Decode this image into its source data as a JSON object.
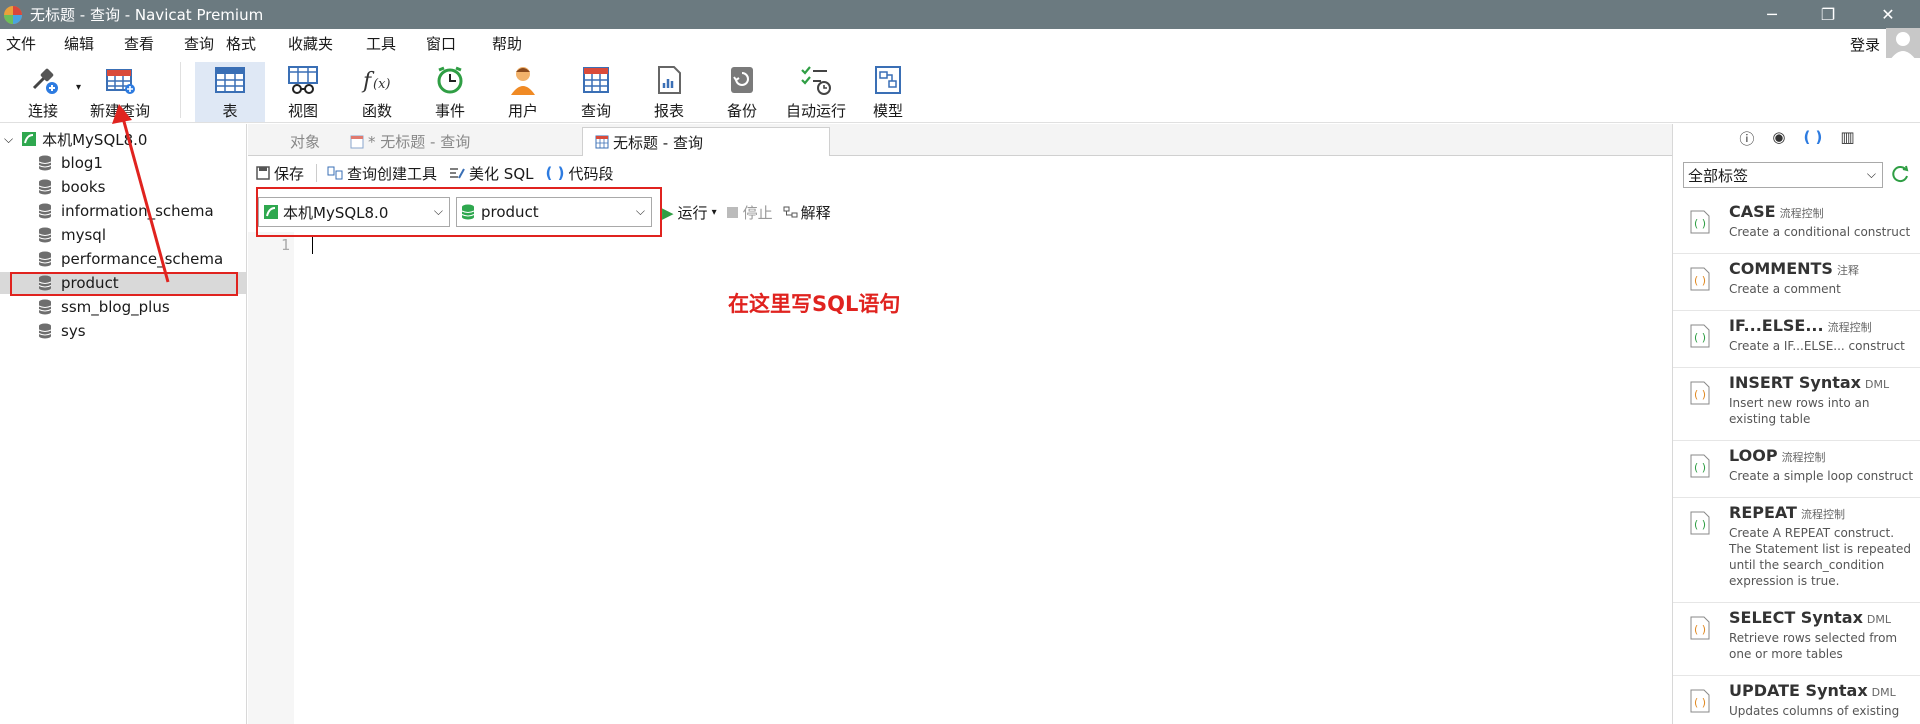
{
  "window": {
    "title": "无标题 - 查询 - Navicat Premium",
    "controls": [
      "minimize-icon",
      "restore-icon",
      "close-icon"
    ]
  },
  "menu": [
    "文件",
    "编辑",
    "查看",
    "查询",
    "格式",
    "收藏夹",
    "工具",
    "窗口",
    "帮助"
  ],
  "account": {
    "login_label": "登录"
  },
  "toolbar": {
    "items": [
      {
        "label": "连接",
        "icon": "plug-icon"
      },
      {
        "label": "新建查询",
        "icon": "new-query-icon"
      },
      {
        "label": "表",
        "icon": "table-icon"
      },
      {
        "label": "视图",
        "icon": "view-icon"
      },
      {
        "label": "函数",
        "icon": "function-icon"
      },
      {
        "label": "事件",
        "icon": "clock-icon"
      },
      {
        "label": "用户",
        "icon": "user-icon"
      },
      {
        "label": "查询",
        "icon": "query-icon"
      },
      {
        "label": "报表",
        "icon": "report-icon"
      },
      {
        "label": "备份",
        "icon": "backup-icon"
      },
      {
        "label": "自动运行",
        "icon": "autorun-icon"
      },
      {
        "label": "模型",
        "icon": "model-icon"
      }
    ]
  },
  "tree": {
    "root": "本机MySQL8.0",
    "databases": [
      "blog1",
      "books",
      "information_schema",
      "mysql",
      "performance_schema",
      "product",
      "ssm_blog_plus",
      "sys"
    ],
    "selected": "product"
  },
  "tabs": [
    {
      "label": "对象",
      "active": false
    },
    {
      "label": "* 无标题 - 查询",
      "active": false
    },
    {
      "label": "无标题 - 查询",
      "active": true
    }
  ],
  "query_toolbar": {
    "save": "保存",
    "builder": "查询创建工具",
    "beautify": "美化 SQL",
    "snippet": "代码段"
  },
  "connection_bar": {
    "connection": "本机MySQL8.0",
    "database": "product",
    "run": "运行",
    "stop": "停止",
    "explain": "解释"
  },
  "editor": {
    "line_number": "1",
    "annotation": "在这里写SQL语句"
  },
  "right_panel": {
    "filter": "全部标签",
    "snippets": [
      {
        "name": "CASE",
        "category": "流程控制",
        "desc": "Create a conditional construct"
      },
      {
        "name": "COMMENTS",
        "category": "注释",
        "desc": "Create a comment"
      },
      {
        "name": "IF...ELSE...",
        "category": "流程控制",
        "desc": "Create a IF...ELSE... construct"
      },
      {
        "name": "INSERT Syntax",
        "category": "DML",
        "desc": "Insert new rows into an existing table"
      },
      {
        "name": "LOOP",
        "category": "流程控制",
        "desc": "Create a simple loop construct"
      },
      {
        "name": "REPEAT",
        "category": "流程控制",
        "desc": "Create A REPEAT construct. The Statement list is repeated until the search_condition expression is true."
      },
      {
        "name": "SELECT Syntax",
        "category": "DML",
        "desc": "Retrieve rows selected from one or more tables"
      },
      {
        "name": "UPDATE Syntax",
        "category": "DML",
        "desc": "Updates columns of existing"
      }
    ]
  },
  "colors": {
    "titlebar": "#6b7a80",
    "annotation_red": "#e0231f",
    "active_tool": "#dfe8f5"
  }
}
